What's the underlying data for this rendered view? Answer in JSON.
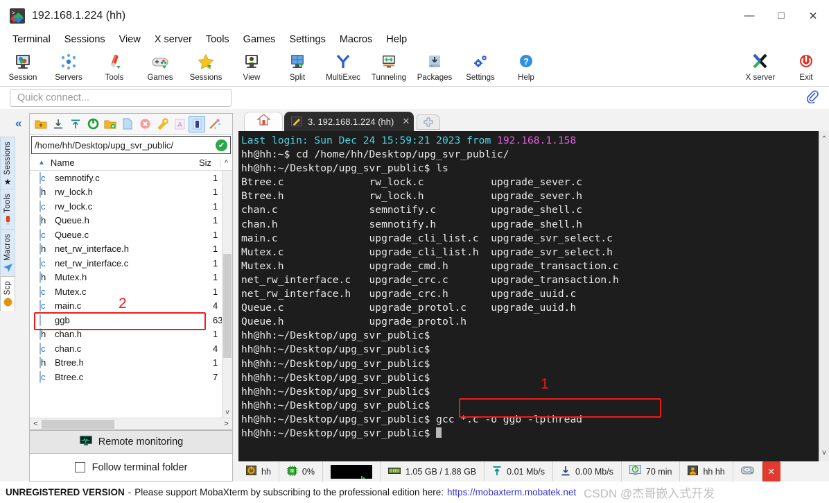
{
  "window": {
    "title": "192.168.1.224 (hh)",
    "app_icon": "mobaxterm-icon",
    "minimize": "—",
    "maximize": "□",
    "close": "✕"
  },
  "menubar": {
    "items": [
      "Terminal",
      "Sessions",
      "View",
      "X server",
      "Tools",
      "Games",
      "Settings",
      "Macros",
      "Help"
    ]
  },
  "toolbar": {
    "buttons": [
      {
        "label": "Session",
        "icon": "session-icon"
      },
      {
        "label": "Servers",
        "icon": "servers-icon"
      },
      {
        "label": "Tools",
        "icon": "tools-icon"
      },
      {
        "label": "Games",
        "icon": "games-icon"
      },
      {
        "label": "Sessions",
        "icon": "star-icon"
      },
      {
        "label": "View",
        "icon": "view-icon"
      },
      {
        "label": "Split",
        "icon": "split-icon"
      },
      {
        "label": "MultiExec",
        "icon": "multiexec-icon"
      },
      {
        "label": "Tunneling",
        "icon": "tunneling-icon"
      },
      {
        "label": "Packages",
        "icon": "packages-icon"
      },
      {
        "label": "Settings",
        "icon": "settings-icon"
      },
      {
        "label": "Help",
        "icon": "help-icon"
      }
    ],
    "right_buttons": [
      {
        "label": "X server",
        "icon": "xserver-icon"
      },
      {
        "label": "Exit",
        "icon": "power-icon"
      }
    ]
  },
  "quick_connect": {
    "placeholder": "Quick connect...",
    "value": "",
    "clip_icon": "paperclip-icon"
  },
  "side_tabs": [
    {
      "label": "Sessions",
      "icon": "star-icon",
      "active": false
    },
    {
      "label": "Tools",
      "icon": "tools-icon",
      "active": false
    },
    {
      "label": "Macros",
      "icon": "macro-icon",
      "active": false
    },
    {
      "label": "Scp",
      "icon": "scp-icon",
      "active": true
    }
  ],
  "collapse_icon": "«",
  "sftp": {
    "toolbar_icons": [
      "parent-folder-icon",
      "download-icon",
      "upload-icon",
      "refresh-icon",
      "new-folder-icon",
      "new-file-icon",
      "delete-icon",
      "permissions-icon",
      "text-mode-icon",
      "binary-mode-icon",
      "magic-icon"
    ],
    "path": "/home/hh/Desktop/upg_svr_public/",
    "path_ok_icon": "check-icon",
    "columns": {
      "name": "Name",
      "size": "Siz"
    },
    "sort_arrow": "▲",
    "files": [
      {
        "name": "semnotify.c",
        "size": "1",
        "type": "c"
      },
      {
        "name": "rw_lock.h",
        "size": "1",
        "type": "h"
      },
      {
        "name": "rw_lock.c",
        "size": "1",
        "type": "c"
      },
      {
        "name": "Queue.h",
        "size": "1",
        "type": "h"
      },
      {
        "name": "Queue.c",
        "size": "1",
        "type": "c"
      },
      {
        "name": "net_rw_interface.h",
        "size": "1",
        "type": "h"
      },
      {
        "name": "net_rw_interface.c",
        "size": "1",
        "type": "c"
      },
      {
        "name": "Mutex.h",
        "size": "1",
        "type": "h"
      },
      {
        "name": "Mutex.c",
        "size": "1",
        "type": "c"
      },
      {
        "name": "main.c",
        "size": "4",
        "type": "c"
      },
      {
        "name": "ggb",
        "size": "63",
        "type": "plain",
        "highlighted": true
      },
      {
        "name": "chan.h",
        "size": "1",
        "type": "h"
      },
      {
        "name": "chan.c",
        "size": "4",
        "type": "c"
      },
      {
        "name": "Btree.h",
        "size": "1",
        "type": "h"
      },
      {
        "name": "Btree.c",
        "size": "7",
        "type": "c"
      }
    ],
    "remote_monitoring": "Remote monitoring",
    "remote_monitoring_icon": "monitor-icon",
    "follow_terminal_folder": "Follow terminal folder",
    "follow_checked": false
  },
  "annotations": [
    {
      "id": "1",
      "target": "gcc-command"
    },
    {
      "id": "2",
      "target": "ggb-file"
    }
  ],
  "tabs": {
    "home_icon": "home-icon",
    "terminal": {
      "icon": "terminal-icon",
      "label": "3. 192.168.1.224 (hh)",
      "close": "✕"
    },
    "new_tab_icon": "plus-icon"
  },
  "terminal": {
    "prompt": "hh@hh:~/Desktop/upg_svr_public$",
    "short_prompt": "hh@hh:~$",
    "lines": [
      {
        "segments": [
          {
            "t": "Last login: Sun Dec 24 15:59:21 2023 from ",
            "c": "cyan"
          },
          {
            "t": "192.168.1.158",
            "c": "magenta"
          }
        ]
      },
      {
        "segments": [
          {
            "t": "hh@hh:~$ cd /home/hh/Desktop/upg_svr_public/",
            "c": "white"
          }
        ]
      },
      {
        "segments": [
          {
            "t": "hh@hh:~/Desktop/upg_svr_public$ ls",
            "c": "white"
          }
        ]
      },
      {
        "segments": [
          {
            "t": "Btree.c              rw_lock.c           upgrade_sever.c",
            "c": "white"
          }
        ]
      },
      {
        "segments": [
          {
            "t": "Btree.h              rw_lock.h           upgrade_sever.h",
            "c": "white"
          }
        ]
      },
      {
        "segments": [
          {
            "t": "chan.c               semnotify.c         upgrade_shell.c",
            "c": "white"
          }
        ]
      },
      {
        "segments": [
          {
            "t": "chan.h               semnotify.h         upgrade_shell.h",
            "c": "white"
          }
        ]
      },
      {
        "segments": [
          {
            "t": "main.c               upgrade_cli_list.c  upgrade_svr_select.c",
            "c": "white"
          }
        ]
      },
      {
        "segments": [
          {
            "t": "Mutex.c              upgrade_cli_list.h  upgrade_svr_select.h",
            "c": "white"
          }
        ]
      },
      {
        "segments": [
          {
            "t": "Mutex.h              upgrade_cmd.h       upgrade_transaction.c",
            "c": "white"
          }
        ]
      },
      {
        "segments": [
          {
            "t": "net_rw_interface.c   upgrade_crc.c       upgrade_transaction.h",
            "c": "white"
          }
        ]
      },
      {
        "segments": [
          {
            "t": "net_rw_interface.h   upgrade_crc.h       upgrade_uuid.c",
            "c": "white"
          }
        ]
      },
      {
        "segments": [
          {
            "t": "Queue.c              upgrade_protol.c    upgrade_uuid.h",
            "c": "white"
          }
        ]
      },
      {
        "segments": [
          {
            "t": "Queue.h              upgrade_protol.h",
            "c": "white"
          }
        ]
      },
      {
        "segments": [
          {
            "t": "hh@hh:~/Desktop/upg_svr_public$",
            "c": "white"
          }
        ]
      },
      {
        "segments": [
          {
            "t": "hh@hh:~/Desktop/upg_svr_public$",
            "c": "white"
          }
        ]
      },
      {
        "segments": [
          {
            "t": "hh@hh:~/Desktop/upg_svr_public$",
            "c": "white"
          }
        ]
      },
      {
        "segments": [
          {
            "t": "hh@hh:~/Desktop/upg_svr_public$",
            "c": "white"
          }
        ]
      },
      {
        "segments": [
          {
            "t": "hh@hh:~/Desktop/upg_svr_public$",
            "c": "white"
          }
        ]
      },
      {
        "segments": [
          {
            "t": "hh@hh:~/Desktop/upg_svr_public$",
            "c": "white"
          }
        ]
      },
      {
        "segments": [
          {
            "t": "hh@hh:~/Desktop/upg_svr_public$ gcc *.c -o ggb -lpthread",
            "c": "white"
          }
        ]
      },
      {
        "segments": [
          {
            "t": "hh@hh:~/Desktop/upg_svr_public$ ",
            "c": "white"
          }
        ],
        "cursor": true
      }
    ],
    "highlighted_command": "gcc *.c -o ggb -lpthread"
  },
  "statusbar": {
    "items": [
      {
        "icon": "user-icon",
        "label": "hh"
      },
      {
        "icon": "cpu-icon",
        "label": "0%"
      },
      {
        "icon": "graph-icon",
        "label": ""
      },
      {
        "icon": "memory-icon",
        "label": "1.05 GB / 1.88 GB"
      },
      {
        "icon": "upload-icon",
        "label": "0.01 Mb/s"
      },
      {
        "icon": "download-icon",
        "label": "0.00 Mb/s"
      },
      {
        "icon": "uptime-icon",
        "label": "70 min"
      },
      {
        "icon": "login-icon",
        "label": "hh  hh"
      },
      {
        "icon": "disk-icon",
        "label": ""
      }
    ],
    "close_icon": "✕"
  },
  "banner": {
    "strong": "UNREGISTERED VERSION",
    "dash": "-",
    "text": "Please support MobaXterm by subscribing to the professional edition here:",
    "link": "https://mobaxterm.mobatek.net",
    "watermark": "CSDN @杰哥嵌入式开发"
  },
  "colors": {
    "accent": "#2a6fbb",
    "highlight_red": "#ef1b1b",
    "terminal_bg": "#1d1d1d",
    "cyan": "#4fd2e0",
    "magenta": "#e45fe4"
  }
}
